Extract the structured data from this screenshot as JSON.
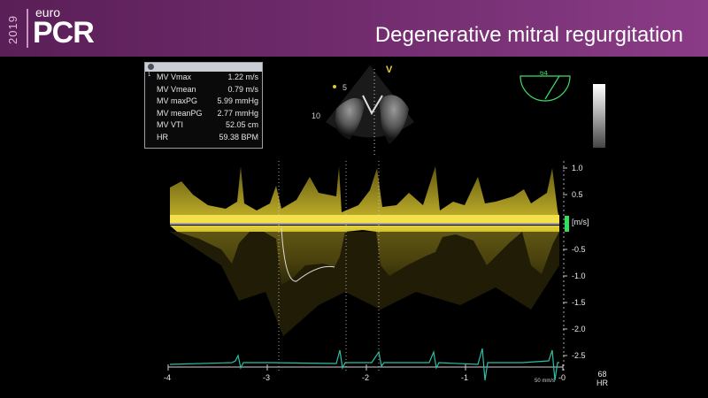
{
  "header": {
    "logo_year": "2019",
    "logo_euro": "euro",
    "logo_pcr": "PCR",
    "title": "Degenerative mitral regurgitation"
  },
  "measurements": {
    "rows": [
      {
        "index": "1",
        "label": "MV Vmax",
        "value": "1.22 m/s"
      },
      {
        "index": "",
        "label": "MV Vmean",
        "value": "0.79 m/s"
      },
      {
        "index": "",
        "label": "MV maxPG",
        "value": "5.99 mmHg"
      },
      {
        "index": "",
        "label": "MV meanPG",
        "value": "2.77 mmHg"
      },
      {
        "index": "",
        "label": "MV VTI",
        "value": "52.05 cm"
      },
      {
        "index": "",
        "label": "HR",
        "value": "59.38 BPM"
      }
    ]
  },
  "echo_view": {
    "depth_5": "5",
    "depth_10": "10",
    "marker": "V",
    "cursor": "1"
  },
  "angle_indicator": {
    "value": "64"
  },
  "doppler": {
    "unit_label": "[m/s]",
    "velocity_ticks": [
      "1.0",
      "0.5",
      "-0.5",
      "-1.0",
      "-1.5",
      "-2.0",
      "-2.5"
    ],
    "time_ticks": [
      "-4",
      "-3",
      "-2",
      "-1",
      "-0"
    ],
    "sweep_speed": "50 mm/s",
    "heart_rate_value": "68",
    "heart_rate_label": "HR"
  },
  "colors": {
    "banner": "#6e2a6b",
    "doppler_signal": "#e8d23a",
    "ecg_trace": "#29c0a8",
    "baseline_marker": "#2ee05a"
  }
}
